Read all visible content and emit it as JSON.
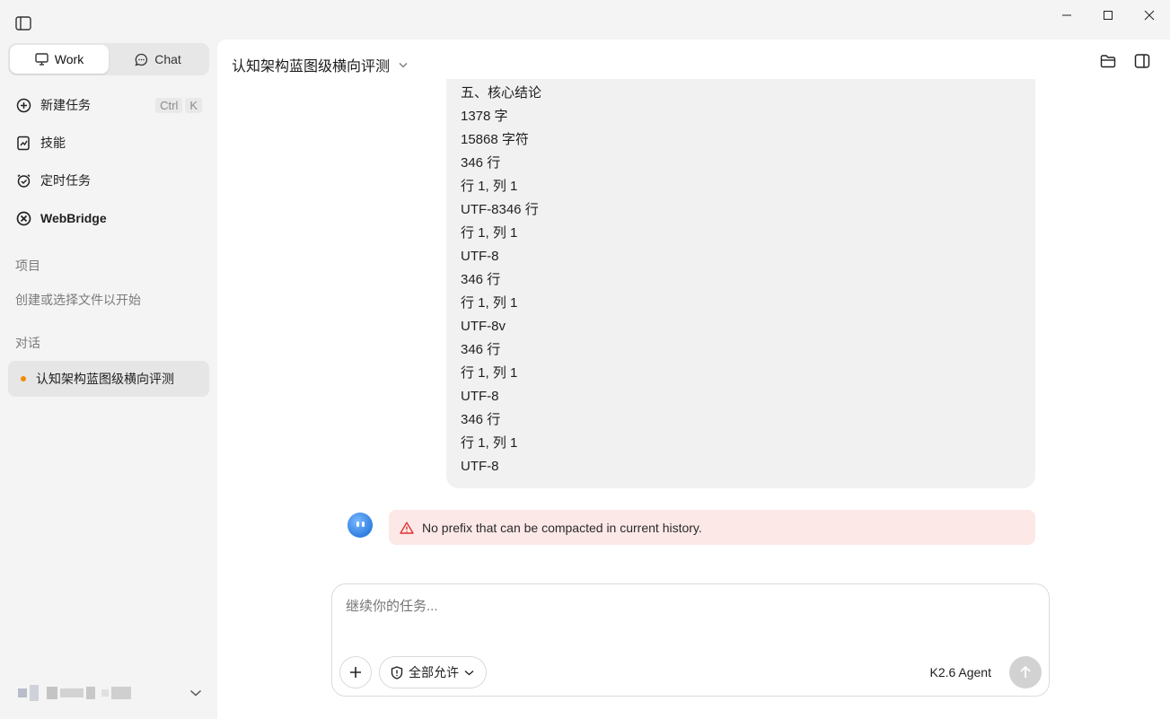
{
  "window": {
    "minimize_icon": "minimize-icon",
    "maximize_icon": "maximize-icon",
    "close_icon": "close-icon"
  },
  "sidebar": {
    "mode_tabs": [
      {
        "label": "Work",
        "icon": "monitor-icon",
        "active": true
      },
      {
        "label": "Chat",
        "icon": "chat-bubble-icon",
        "active": false
      }
    ],
    "nav": [
      {
        "label": "新建任务",
        "icon": "plus-circle-icon",
        "shortcut": [
          "Ctrl",
          "K"
        ]
      },
      {
        "label": "技能",
        "icon": "skills-icon"
      },
      {
        "label": "定时任务",
        "icon": "alarm-clock-icon"
      },
      {
        "label": "WebBridge",
        "icon": "webbridge-icon"
      }
    ],
    "projects_label": "项目",
    "projects_empty": "创建或选择文件以开始",
    "conversations_label": "对话",
    "conversations": [
      {
        "label": "认知架构蓝图级横向评测",
        "status_color": "#f08c00"
      }
    ]
  },
  "main": {
    "title": "认知架构蓝图级横向评测",
    "message_lines": [
      "五、核心结论",
      "1378 字",
      "15868 字符",
      "346 行",
      "行 1, 列 1",
      "UTF-8346 行",
      "行 1, 列 1",
      "UTF-8",
      "346 行",
      "行 1, 列 1",
      "UTF-8v",
      "346 行",
      "行 1, 列 1",
      "UTF-8",
      "346 行",
      "行 1, 列 1",
      "UTF-8"
    ],
    "error_text": "No prefix that can be compacted in current history.",
    "composer": {
      "placeholder": "继续你的任务...",
      "permission_label": "全部允许",
      "model_label": "K2.6 Agent"
    }
  },
  "colors": {
    "accent": "#2f7fe0",
    "error_bg": "#fde8e8",
    "error_icon": "#e03131"
  }
}
